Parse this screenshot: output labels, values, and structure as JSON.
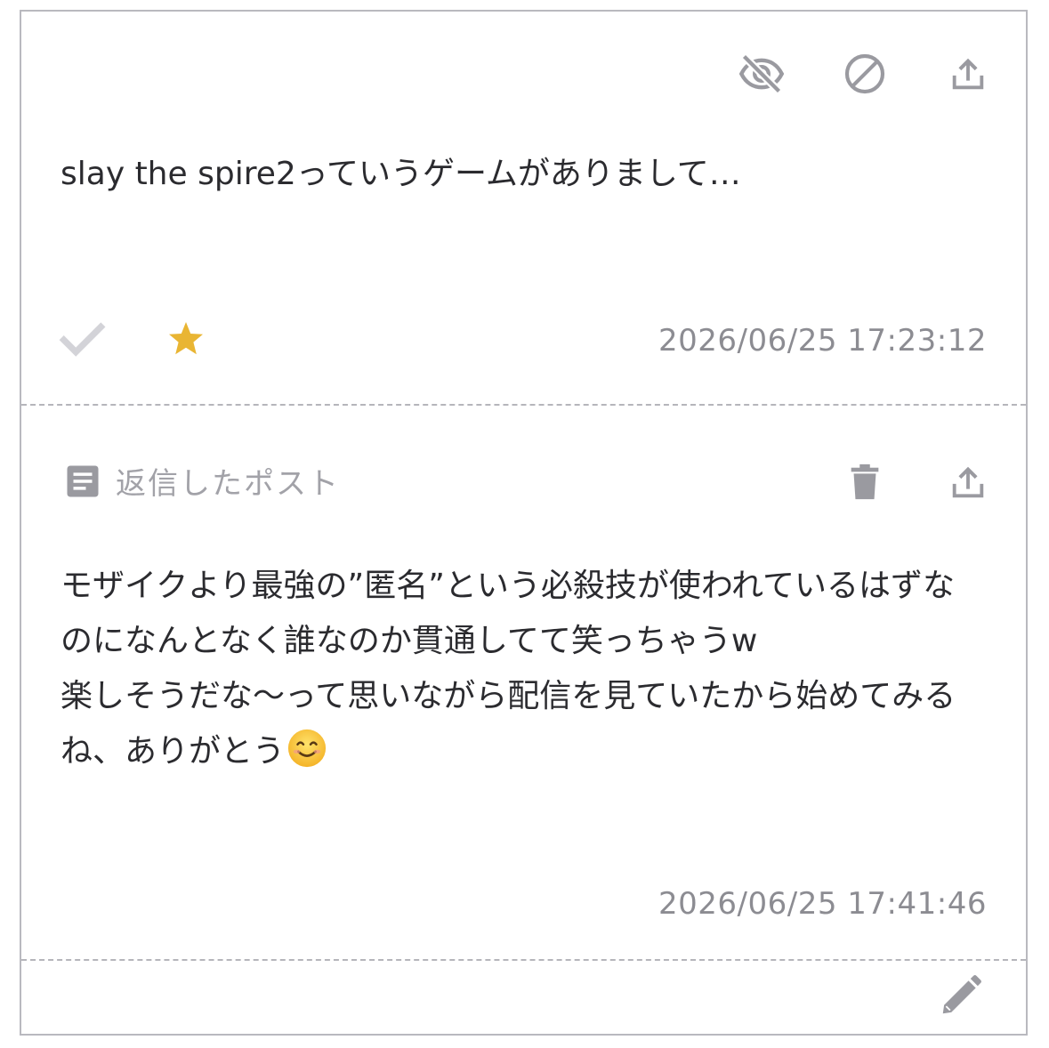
{
  "post": {
    "text": "slay the spire2っていうゲームがありまして…",
    "timestamp": "2026/06/25 17:23:12",
    "icons": {
      "hide": "eye-off-icon",
      "block": "block-icon",
      "share": "share-upload-icon",
      "check": "checkmark-icon",
      "favorite": "star-icon"
    },
    "favorite_color": "#E9B533"
  },
  "reply": {
    "label": "返信したポスト",
    "text": "モザイクより最強の”匿名”という必殺技が使われているはずなのになんとなく誰なのか貫通してて笑っちゃうw\n楽しそうだな〜って思いながら配信を見ていたから始めてみるね、ありがとう",
    "emoji": "😊",
    "timestamp": "2026/06/25 17:41:46",
    "icons": {
      "doc": "document-icon",
      "delete": "trash-icon",
      "share": "share-upload-icon"
    }
  },
  "footer": {
    "icons": {
      "edit": "pencil-icon"
    }
  },
  "colors": {
    "icon_gray": "#9A9AA0",
    "text": "#2B2B2F",
    "muted": "#8C8C92",
    "border": "#B9B9BF"
  }
}
